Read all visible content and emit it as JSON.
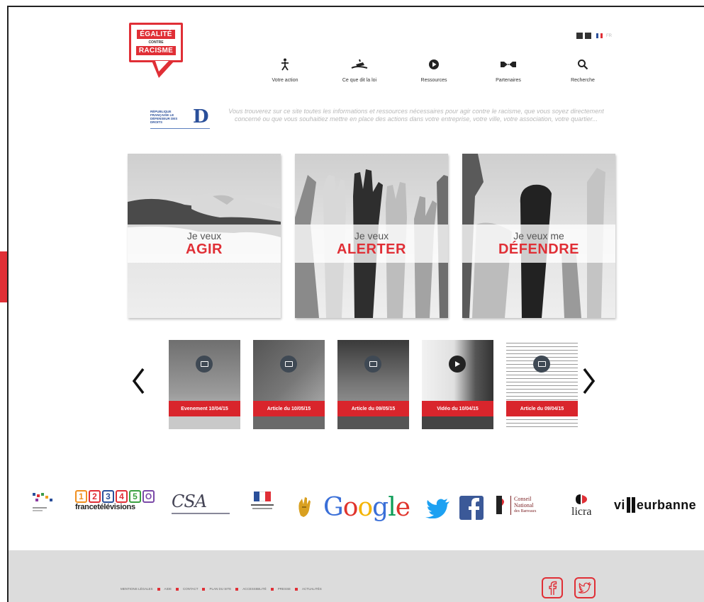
{
  "logo": {
    "line1": "ÉGALITÉ",
    "line2": "CONTRE",
    "line3": "RACISME"
  },
  "lang": {
    "active": "FR"
  },
  "nav": [
    {
      "label": "Votre action",
      "icon": "person-walking-icon"
    },
    {
      "label": "Ce que dit la loi",
      "icon": "gavel-icon"
    },
    {
      "label": "Ressources",
      "icon": "play-circle-icon"
    },
    {
      "label": "Partenaires",
      "icon": "handshake-icon"
    },
    {
      "label": "Recherche",
      "icon": "search-icon"
    }
  ],
  "defenseur": {
    "text": "RÉPUBLIQUE FRANÇAISE LE DÉFENSEUR DES DROITS"
  },
  "intro": "Vous trouverez sur ce site toutes les informations et ressources nécessaires pour agir contre le racisme, que vous soyez directement concerné ou que vous souhaitiez mettre en place des actions dans votre entreprise, votre ville, votre association, votre quartier...",
  "hero": [
    {
      "small": "Je veux",
      "big": "AGIR"
    },
    {
      "small": "Je veux",
      "big": "ALERTER"
    },
    {
      "small": "Je veux me",
      "big": "DÉFENDRE"
    }
  ],
  "carousel": [
    {
      "label": "Evenement 10/04/15",
      "type": "event"
    },
    {
      "label": "Article du 10/05/15",
      "type": "article"
    },
    {
      "label": "Article du 09/05/15",
      "type": "article"
    },
    {
      "label": "Vidéo du 10/04/15",
      "type": "video"
    },
    {
      "label": "Article du 09/04/15",
      "type": "article"
    }
  ],
  "partners": {
    "google": "Google",
    "ftv_boxes": [
      "1",
      "2",
      "3",
      "4",
      "5",
      "O"
    ],
    "ftv_text": "francetélévisions",
    "csa": "CSA",
    "cn": [
      "Conseil",
      "National",
      "des Barreaux"
    ],
    "licra": "licra",
    "villeurbanne_pre": "vi",
    "villeurbanne_post": "eurbanne"
  },
  "footer": {
    "links": [
      "MENTIONS LÉGALES",
      "AIDE",
      "CONTACT",
      "PLAN DU SITE",
      "ACCESSIBILITÉ",
      "PRESSE",
      "ACTUALITÉS"
    ]
  },
  "colors": {
    "accent": "#e02f36",
    "footer_bg": "#dcdcdc"
  }
}
